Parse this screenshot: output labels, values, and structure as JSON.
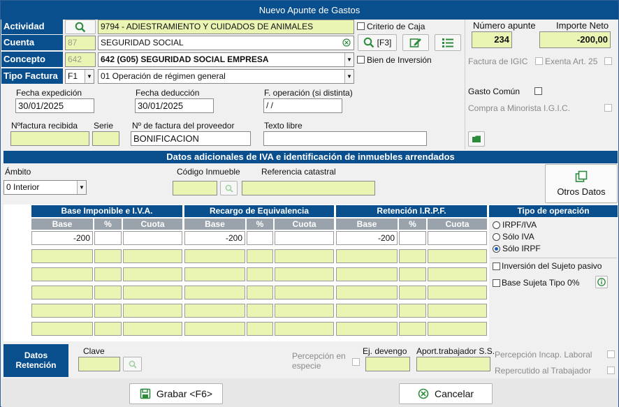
{
  "window": {
    "title": "Nuevo Apunte de Gastos"
  },
  "header": {
    "actividad_label": "Actividad",
    "actividad_value": "9794 - ADIESTRAMIENTO Y CUIDADOS DE ANIMALES",
    "criterio_caja": "Criterio de Caja",
    "cuenta_label": "Cuenta",
    "cuenta_code": "87",
    "cuenta_value": "SEGURIDAD SOCIAL",
    "f3_label": "[F3]",
    "concepto_label": "Concepto",
    "concepto_code": "642",
    "concepto_value": "642  (G05)  SEGURIDAD SOCIAL EMPRESA",
    "bien_inversion": "Bien de Inversión",
    "tipo_factura_label": "Tipo Factura",
    "tipo_factura_code": "F1",
    "tipo_factura_value": "01   Operación de régimen general"
  },
  "right_panel": {
    "numero_apunte_label": "Número apunte",
    "numero_apunte": "234",
    "importe_neto_label": "Importe Neto",
    "importe_neto": "-200,00",
    "factura_igic": "Factura de IGIC",
    "exenta_art25": "Exenta Art. 25",
    "gasto_comun": "Gasto Común",
    "compra_minorista": "Compra a Minorista I.G.I.C."
  },
  "dates": {
    "fecha_expedicion_label": "Fecha expedición",
    "fecha_expedicion": "30/01/2025",
    "fecha_deduccion_label": "Fecha deducción",
    "fecha_deduccion": "30/01/2025",
    "f_operacion_label": "F. operación (si distinta)",
    "f_operacion": " /  /",
    "nfactura_label": "Nºfactura recibida",
    "serie_label": "Serie",
    "nfactura_proveedor_label": "Nº de factura del proveedor",
    "nfactura_proveedor": "BONIFICACION",
    "texto_libre_label": "Texto libre"
  },
  "iva_section": {
    "title": "Datos adicionales de IVA e identificación de inmuebles arrendados",
    "ambito_label": "Ámbito",
    "ambito_value": "0  Interior",
    "codigo_inmueble_label": "Código Inmueble",
    "referencia_catastral_label": "Referencia catastral",
    "otros_datos": "Otros Datos"
  },
  "grid": {
    "base_imponible": "Base Imponible e I.V.A.",
    "recargo": "Recargo de Equivalencia",
    "retencion": "Retención I.R.P.F.",
    "tipo_operacion": "Tipo de operación",
    "col_base": "Base",
    "col_pct": "%",
    "col_cuota": "Cuota",
    "row1_base_iva": "-200",
    "row1_base_rec": "-200",
    "row1_base_ret": "-200"
  },
  "tipo_operacion": {
    "opt1": "IRPF/IVA",
    "opt2": "Sólo IVA",
    "opt3": "Sólo IRPF",
    "selected": "Sólo IRPF",
    "inversion_sujeto": "Inversión del Sujeto pasivo",
    "base_sujeta": "Base Sujeta Tipo 0%"
  },
  "retencion": {
    "label": "Datos Retención",
    "clave_label": "Clave",
    "percepcion_especie": "Percepción en especie",
    "ej_devengo_label": "Ej. devengo",
    "aport_trabajador_label": "Aport.trabajador S.S.",
    "percepcion_incap": "Percepción Incap. Laboral",
    "repercutido": "Repercutido al Trabajador"
  },
  "footer": {
    "grabar": "Grabar <F6>",
    "cancelar": "Cancelar"
  },
  "colors": {
    "accent": "#0a4f8d",
    "field_yellow": "#eaf5b4",
    "icon_green": "#2e8b3e"
  }
}
